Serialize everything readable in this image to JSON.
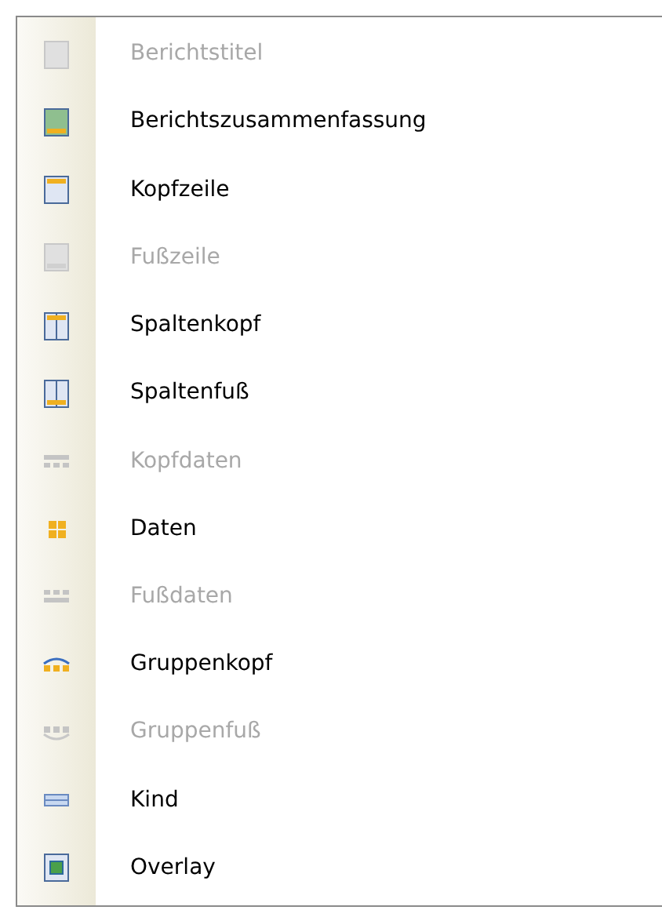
{
  "menu": {
    "items": [
      {
        "label": "Berichtstitel",
        "kind": "title",
        "disabled": true
      },
      {
        "label": "Berichtszusammenfassung",
        "kind": "summary",
        "disabled": false
      },
      {
        "label": "Kopfzeile",
        "kind": "pageheader",
        "disabled": false
      },
      {
        "label": "Fußzeile",
        "kind": "pagefooter",
        "disabled": true
      },
      {
        "label": "Spaltenkopf",
        "kind": "colheader",
        "disabled": false
      },
      {
        "label": "Spaltenfuß",
        "kind": "colfooter",
        "disabled": false
      },
      {
        "label": "Kopfdaten",
        "kind": "dataheader",
        "disabled": true
      },
      {
        "label": "Daten",
        "kind": "data",
        "disabled": false
      },
      {
        "label": "Fußdaten",
        "kind": "datafooter",
        "disabled": true
      },
      {
        "label": "Gruppenkopf",
        "kind": "groupheader",
        "disabled": false
      },
      {
        "label": "Gruppenfuß",
        "kind": "groupfooter",
        "disabled": true
      },
      {
        "label": "Kind",
        "kind": "child",
        "disabled": false
      },
      {
        "label": "Overlay",
        "kind": "overlay",
        "disabled": false
      }
    ]
  }
}
